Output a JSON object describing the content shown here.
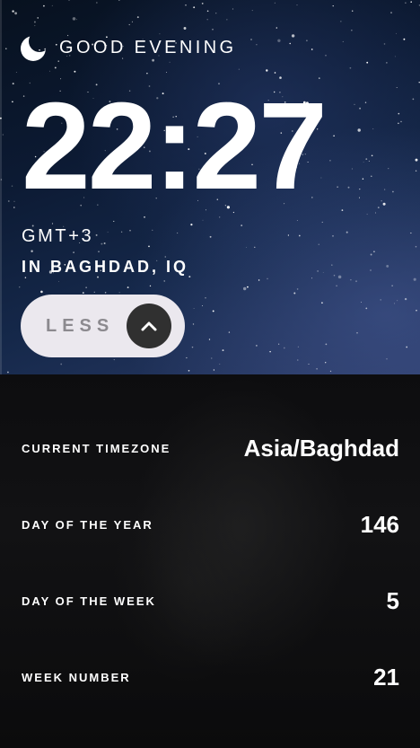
{
  "greeting": {
    "icon": "moon-icon",
    "text": "GOOD EVENING"
  },
  "clock": {
    "time": "22:27",
    "timezone_abbr": "GMT+3",
    "location": "IN BAGHDAD, IQ"
  },
  "toggle": {
    "label": "LESS",
    "icon": "chevron-up-icon"
  },
  "details": [
    {
      "label": "CURRENT TIMEZONE",
      "value": "Asia/Baghdad"
    },
    {
      "label": "DAY OF THE YEAR",
      "value": "146"
    },
    {
      "label": "DAY OF THE WEEK",
      "value": "5"
    },
    {
      "label": "WEEK NUMBER",
      "value": "21"
    }
  ],
  "colors": {
    "toggle_bg": "#ebe8ee",
    "toggle_text": "#8c8a8f",
    "toggle_circle": "#303030",
    "panel_bg": "#0d0d0f",
    "sky_top": "#07111f",
    "sky_bottom": "#2a3a66"
  }
}
